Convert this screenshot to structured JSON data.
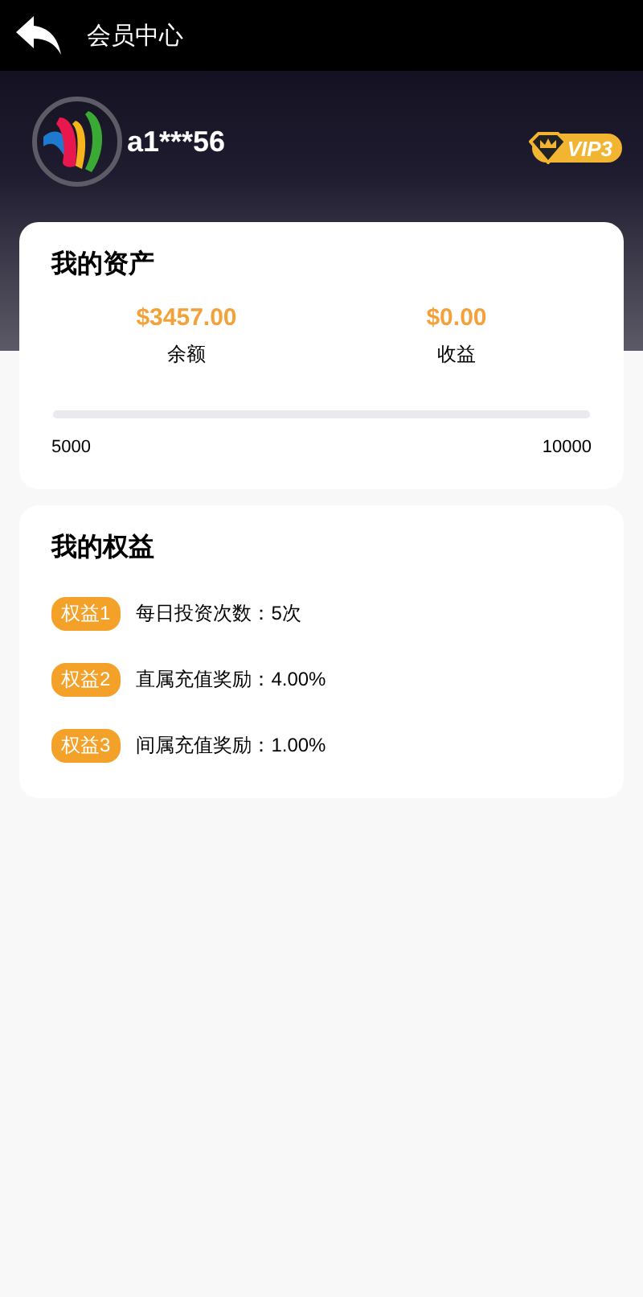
{
  "header": {
    "title": "会员中心"
  },
  "profile": {
    "username": "a1***56",
    "vip_badge": "VIP3"
  },
  "assets": {
    "title": "我的资产",
    "stats": [
      {
        "value": "$3457.00",
        "label": "余额"
      },
      {
        "value": "$0.00",
        "label": "收益"
      }
    ],
    "progress": {
      "level": 0,
      "min_label": "5000",
      "max_label": "10000"
    }
  },
  "benefits": {
    "title": "我的权益",
    "items": [
      {
        "tag": "权益1",
        "text": "每日投资次数：5次"
      },
      {
        "tag": "权益2",
        "text": "直属充值奖励：4.00%"
      },
      {
        "tag": "权益3",
        "text": "间属充值奖励：1.00%"
      }
    ]
  }
}
